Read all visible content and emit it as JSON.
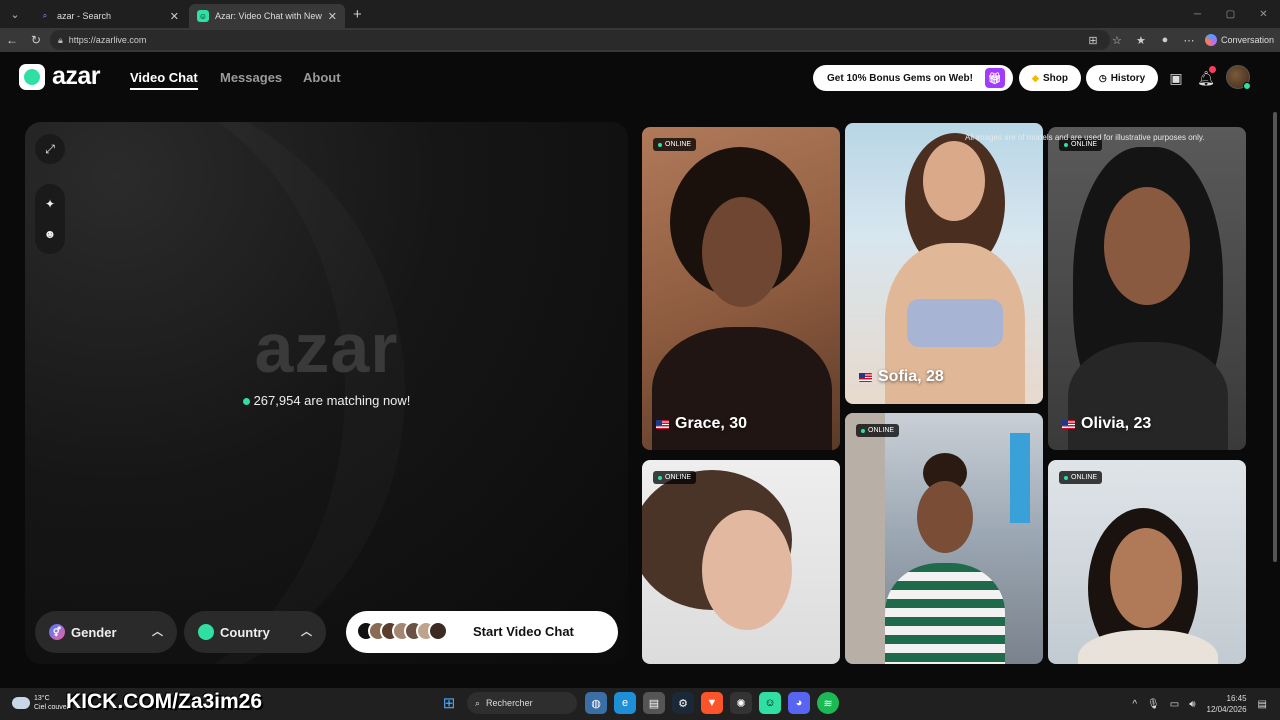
{
  "browser": {
    "tabs": [
      {
        "title": "azar - Search",
        "favicon": "search-icon",
        "active": false
      },
      {
        "title": "Azar: Video Chat with New People",
        "favicon": "azar-logo-icon",
        "active": true
      }
    ],
    "url": "https://azarlive.com",
    "copilot_label": "Conversation"
  },
  "site": {
    "logo_text": "azar",
    "nav": [
      {
        "label": "Video Chat",
        "active": true
      },
      {
        "label": "Messages",
        "active": false
      },
      {
        "label": "About",
        "active": false
      }
    ],
    "promo_label": "Get 10% Bonus Gems on Web!",
    "shop_label": "Shop",
    "history_label": "History",
    "notification_badge": "1",
    "accent_color": "#2fe0a2"
  },
  "video": {
    "watermark": "azar",
    "matching_text": "267,954 are matching now!",
    "gender_label": "Gender",
    "country_label": "Country",
    "start_label": "Start Video Chat"
  },
  "gallery": {
    "disclaimer": "All images are of models and are used for illustrative purposes only.",
    "online_label": "ONLINE",
    "profiles": [
      {
        "name": "Grace, 30",
        "flag": "us-flag-icon",
        "online": true
      },
      {
        "name": "Sofia, 28",
        "flag": "us-flag-icon",
        "online": false
      },
      {
        "name": "Olivia, 23",
        "flag": "us-flag-icon",
        "online": true
      },
      {
        "name": "",
        "online": true
      },
      {
        "name": "",
        "online": true
      },
      {
        "name": "",
        "online": true
      }
    ]
  },
  "taskbar": {
    "temperature": "13°C",
    "weather_text": "Ciel couvert",
    "overlay_text": "KICK.COM/Za3im26",
    "search_placeholder": "Rechercher",
    "time": "16:45",
    "date": "12/04/2026"
  }
}
